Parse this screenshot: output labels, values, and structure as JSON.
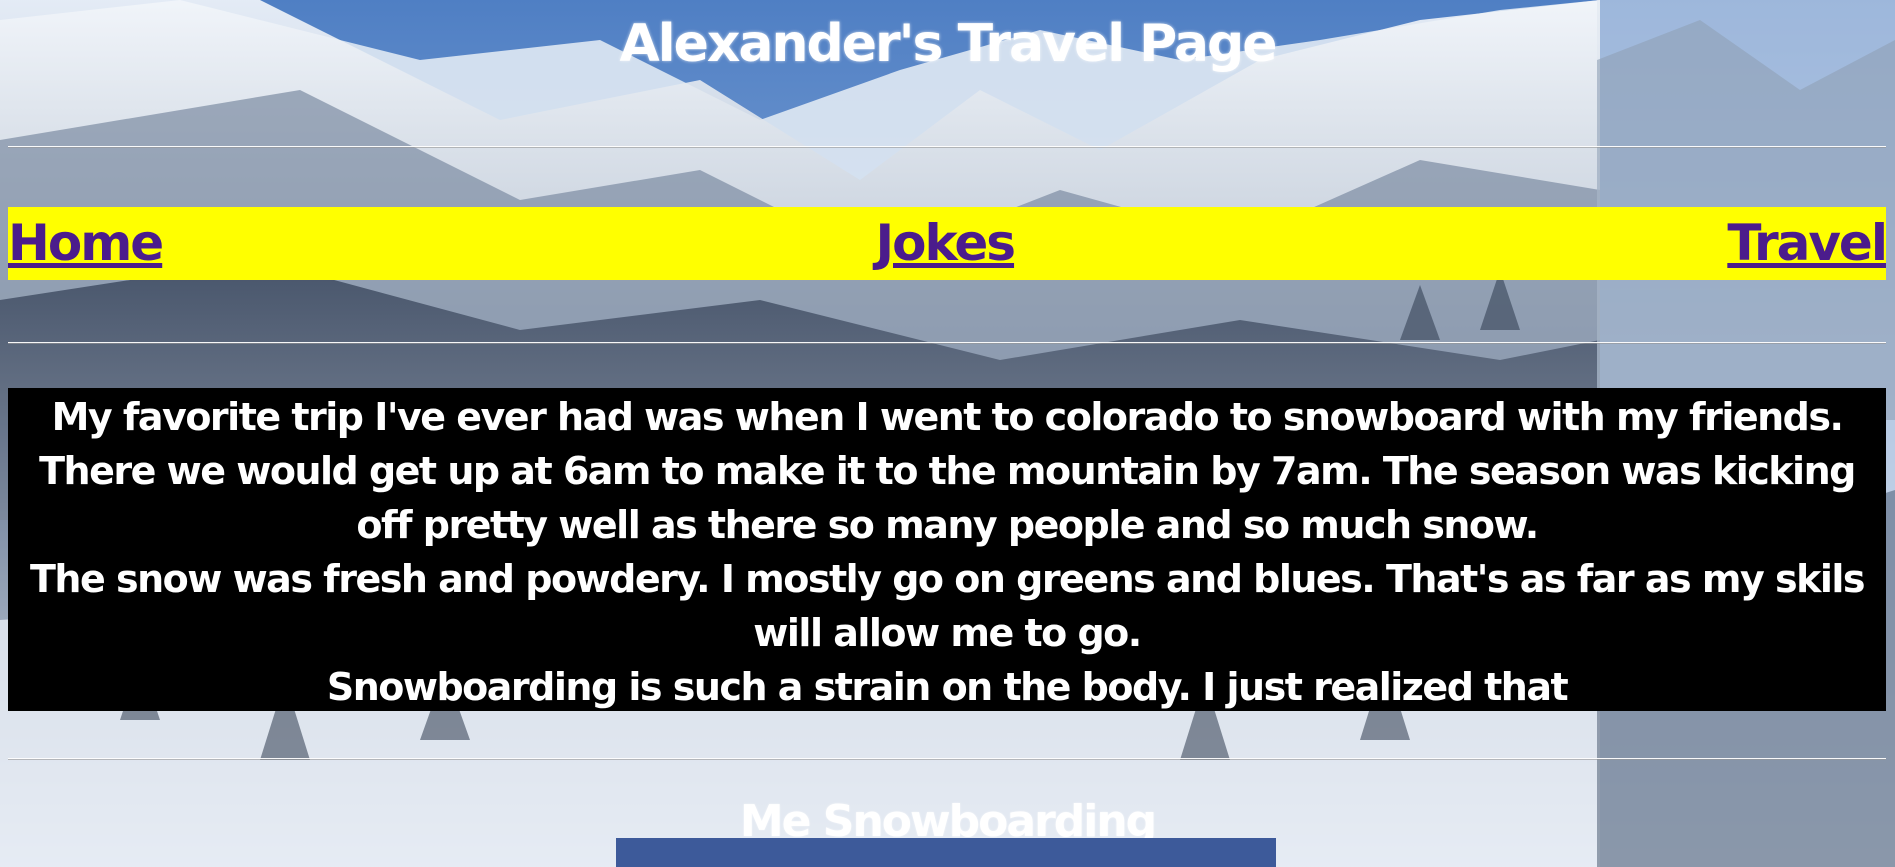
{
  "page": {
    "title": "Alexander's Travel Page",
    "background_image": "snowy-mountains-ski-resort"
  },
  "nav": {
    "background_color": "#ffff00",
    "link_color": "#4b1c8c",
    "items": [
      {
        "label": "Home"
      },
      {
        "label": "Jokes"
      },
      {
        "label": "Travel"
      }
    ]
  },
  "story": {
    "paragraphs": [
      "My favorite trip I've ever had was when I went to colorado to snowboard with my friends.",
      "There we would get up at 6am to make it to the mountain by 7am. The season was kicking off pretty well as there so many people and so much snow.",
      "The snow was fresh and powdery. I mostly go on greens and blues. That's as far as my skils will allow me to go.",
      "Snowboarding is such a strain on the body. I just realized that"
    ]
  },
  "photo_section": {
    "caption": "Me Snowboarding",
    "image": "snowboarding-photo"
  }
}
